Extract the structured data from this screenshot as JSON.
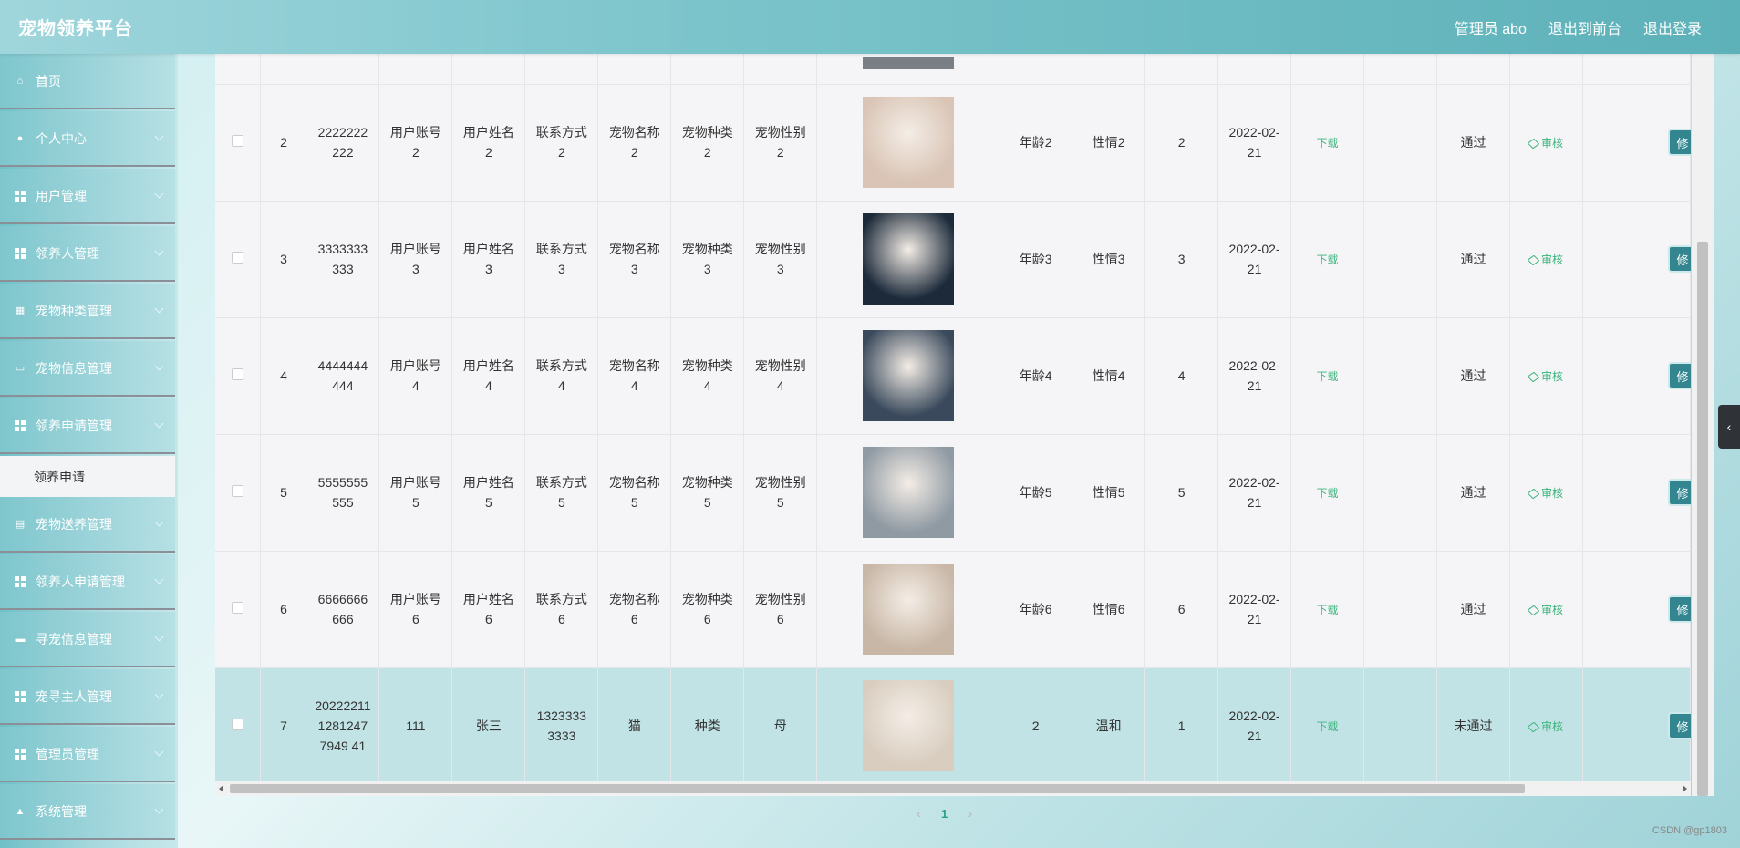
{
  "app": {
    "title": "宠物领养平台"
  },
  "header": {
    "links": [
      "管理员 abo",
      "退出到前台",
      "退出登录"
    ]
  },
  "sidebar": {
    "items": [
      {
        "label": "首页",
        "icon": "home-icon"
      },
      {
        "label": "个人中心",
        "icon": "user-icon"
      },
      {
        "label": "用户管理",
        "icon": "grid-icon"
      },
      {
        "label": "领养人管理",
        "icon": "grid-icon"
      },
      {
        "label": "宠物种类管理",
        "icon": "chart-icon"
      },
      {
        "label": "宠物信息管理",
        "icon": "monitor-icon"
      },
      {
        "label": "领养申请管理",
        "icon": "grid-icon"
      },
      {
        "label": "宠物送养管理",
        "icon": "clipboard-icon"
      },
      {
        "label": "领养人申请管理",
        "icon": "grid-icon"
      },
      {
        "label": "寻宠信息管理",
        "icon": "printer-icon"
      },
      {
        "label": "宠寻主人管理",
        "icon": "grid-icon"
      },
      {
        "label": "管理员管理",
        "icon": "grid-icon"
      },
      {
        "label": "系统管理",
        "icon": "person-icon"
      }
    ],
    "active_subitem": "领养申请"
  },
  "table": {
    "rows": [
      {
        "idx": "2",
        "account": "2222222222",
        "user": "用户账号2",
        "name": "用户姓名2",
        "contact": "联系方式2",
        "pet": "宠物名称2",
        "kind": "宠物种类2",
        "sex": "宠物性别2",
        "age": "年龄2",
        "temper": "性情2",
        "num": "2",
        "date": "2022-02-21",
        "download": "下载",
        "status": "通过",
        "review": "审核",
        "action": "修"
      },
      {
        "idx": "3",
        "account": "3333333333",
        "user": "用户账号3",
        "name": "用户姓名3",
        "contact": "联系方式3",
        "pet": "宠物名称3",
        "kind": "宠物种类3",
        "sex": "宠物性别3",
        "age": "年龄3",
        "temper": "性情3",
        "num": "3",
        "date": "2022-02-21",
        "download": "下载",
        "status": "通过",
        "review": "审核",
        "action": "修"
      },
      {
        "idx": "4",
        "account": "4444444444",
        "user": "用户账号4",
        "name": "用户姓名4",
        "contact": "联系方式4",
        "pet": "宠物名称4",
        "kind": "宠物种类4",
        "sex": "宠物性别4",
        "age": "年龄4",
        "temper": "性情4",
        "num": "4",
        "date": "2022-02-21",
        "download": "下载",
        "status": "通过",
        "review": "审核",
        "action": "修"
      },
      {
        "idx": "5",
        "account": "5555555555",
        "user": "用户账号5",
        "name": "用户姓名5",
        "contact": "联系方式5",
        "pet": "宠物名称5",
        "kind": "宠物种类5",
        "sex": "宠物性别5",
        "age": "年龄5",
        "temper": "性情5",
        "num": "5",
        "date": "2022-02-21",
        "download": "下载",
        "status": "通过",
        "review": "审核",
        "action": "修"
      },
      {
        "idx": "6",
        "account": "6666666666",
        "user": "用户账号6",
        "name": "用户姓名6",
        "contact": "联系方式6",
        "pet": "宠物名称6",
        "kind": "宠物种类6",
        "sex": "宠物性别6",
        "age": "年龄6",
        "temper": "性情6",
        "num": "6",
        "date": "2022-02-21",
        "download": "下载",
        "status": "通过",
        "review": "审核",
        "action": "修"
      },
      {
        "idx": "7",
        "account": "2022221112812477949 41",
        "user": "111",
        "name": "张三",
        "contact": "13233333333",
        "pet": "猫",
        "kind": "种类",
        "sex": "母",
        "age": "2",
        "temper": "温和",
        "num": "1",
        "date": "2022-02-21",
        "download": "下载",
        "status": "未通过",
        "review": "审核",
        "action": "修"
      }
    ],
    "thumb_colors": [
      "#d9c4b5",
      "#1c2a3a",
      "#3a4a5c",
      "#8f9aa3",
      "#c8b7a6",
      "#d8cdbf"
    ]
  },
  "pagination": {
    "current": "1"
  },
  "watermark": "CSDN @gp1803"
}
